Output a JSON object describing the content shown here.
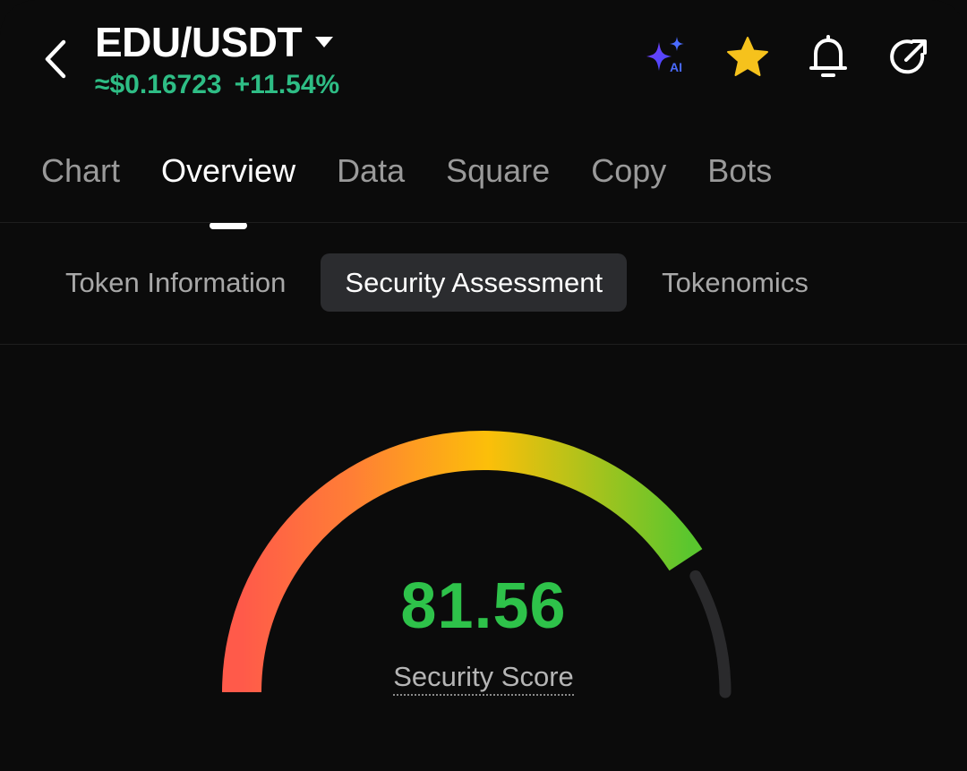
{
  "header": {
    "pair": "EDU/USDT",
    "price": "≈$0.16723",
    "change": "+11.54%",
    "icons": [
      "back-arrow-icon",
      "dropdown-caret-icon",
      "ai-sparkle-icon",
      "star-icon",
      "bell-icon",
      "share-icon"
    ],
    "ai_badge": "AI"
  },
  "tabs": [
    {
      "label": "Chart",
      "active": false
    },
    {
      "label": "Overview",
      "active": true
    },
    {
      "label": "Data",
      "active": false
    },
    {
      "label": "Square",
      "active": false
    },
    {
      "label": "Copy",
      "active": false
    },
    {
      "label": "Bots",
      "active": false
    }
  ],
  "subtabs": [
    {
      "label": "Token Information",
      "active": false
    },
    {
      "label": "Security Assessment",
      "active": true
    },
    {
      "label": "Tokenomics",
      "active": false
    }
  ],
  "security": {
    "score": "81.56",
    "score_value": 81.56,
    "score_max": 100,
    "label": "Security Score"
  },
  "colors": {
    "price_green": "#2ebd85",
    "score_green": "#2ec24a",
    "star_yellow": "#f6c21c",
    "gauge_start": "#ff5a4a",
    "gauge_mid": "#fcbf09",
    "gauge_end": "#5ac62e",
    "track": "#2a2a2c"
  }
}
